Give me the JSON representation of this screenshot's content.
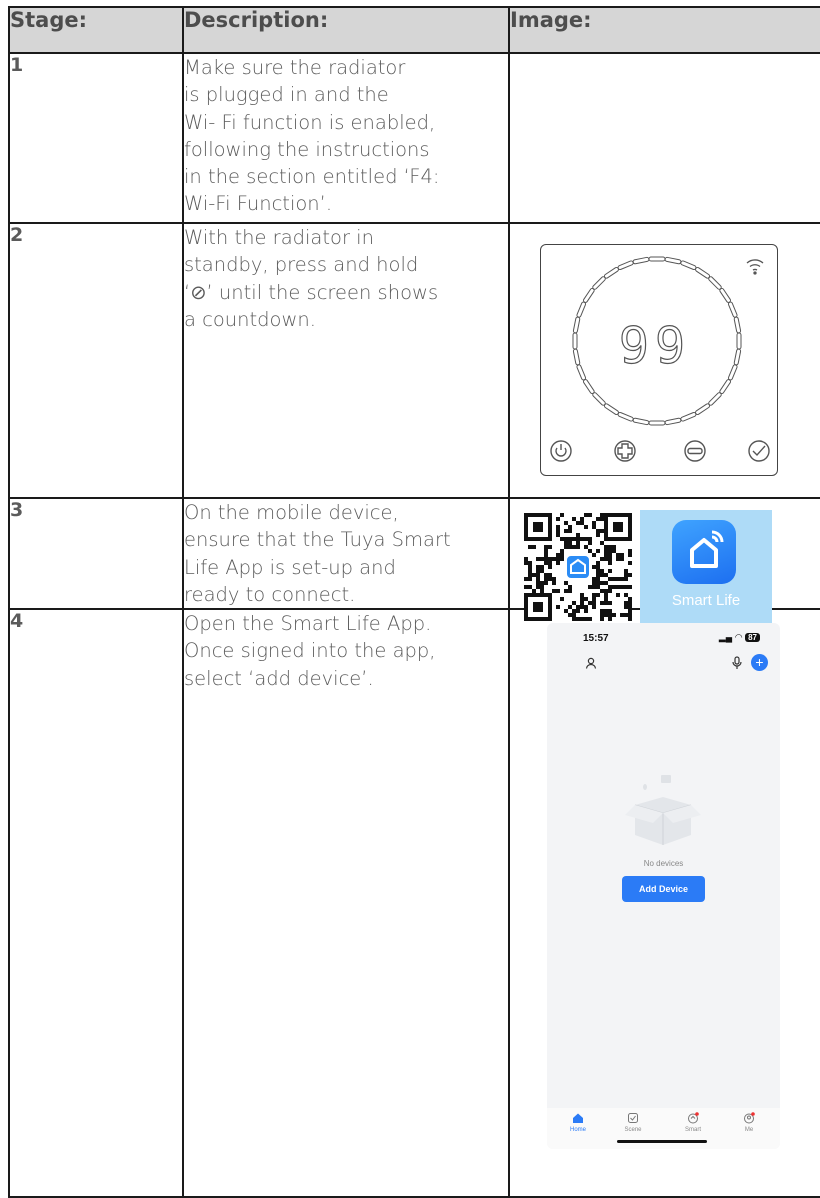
{
  "table": {
    "headers": {
      "stage": "Stage:",
      "description": "Description:",
      "image": "Image:"
    },
    "rows": [
      {
        "stage": "1",
        "lines": [
          "Make sure the radiator",
          "is plugged in and the",
          "Wi- Fi function is enabled,",
          "following the instructions",
          "in the section entitled ‘F4:",
          "Wi-Fi Function’."
        ]
      },
      {
        "stage": "2",
        "lines": [
          "With the radiator in",
          "standby, press and hold",
          "‘⊘’ until the screen shows",
          "a countdown."
        ],
        "thermostat_display": "99"
      },
      {
        "stage": "3",
        "lines": [
          "On the mobile device,",
          "ensure that the Tuya Smart",
          "Life App is set-up and",
          "ready to connect."
        ],
        "app_label": "Smart Life"
      },
      {
        "stage": "4",
        "lines": [
          "Open the Smart Life App.",
          "Once signed into the app,",
          "select ‘add device’."
        ],
        "phone": {
          "time": "15:57",
          "battery": "87",
          "no_devices": "No devices",
          "add_device": "Add Device",
          "tabs": [
            "Home",
            "Scene",
            "Smart",
            "Me"
          ]
        }
      }
    ]
  },
  "colors": {
    "header_bg": "#d6d6d6",
    "text": "#5b5b5b",
    "accent_blue": "#2b7bf6"
  }
}
